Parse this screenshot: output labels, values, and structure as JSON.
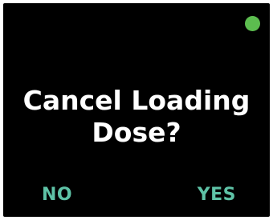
{
  "dialog": {
    "title_line1": "Cancel Loading",
    "title_line2": "Dose?"
  },
  "status": {
    "indicator_color": "#5cbd4f"
  },
  "soft_keys": {
    "left_label": "NO",
    "right_label": "YES",
    "color": "#5ec2a6"
  }
}
